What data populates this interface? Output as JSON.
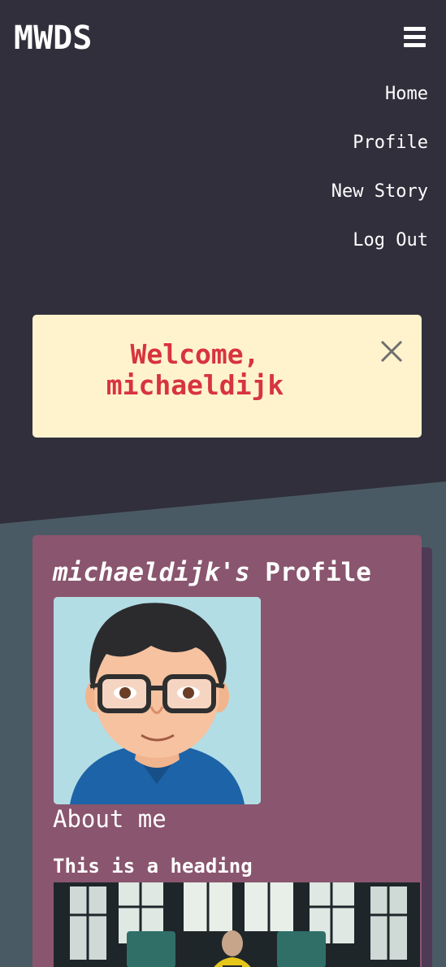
{
  "header": {
    "brand": "MWDS",
    "menu_icon": "hamburger-menu-icon"
  },
  "nav": {
    "items": [
      {
        "label": "Home"
      },
      {
        "label": "Profile"
      },
      {
        "label": "New Story"
      },
      {
        "label": "Log Out"
      }
    ]
  },
  "alert": {
    "message_line1": "Welcome,",
    "message_line2": "michaeldijk",
    "close_icon": "close-icon",
    "background": "#fff3cd",
    "text_color": "#d7343f"
  },
  "profile": {
    "username": "michaeldijk's",
    "title_suffix": " Profile",
    "avatar_icon": "cartoon-avatar",
    "about_label": "About me",
    "story_heading": "This is a heading"
  },
  "colors": {
    "header_bg": "#302f3b",
    "page_bg": "#4a5a64",
    "card_bg": "#8a556e",
    "card_shadow": "#4f3a56"
  }
}
